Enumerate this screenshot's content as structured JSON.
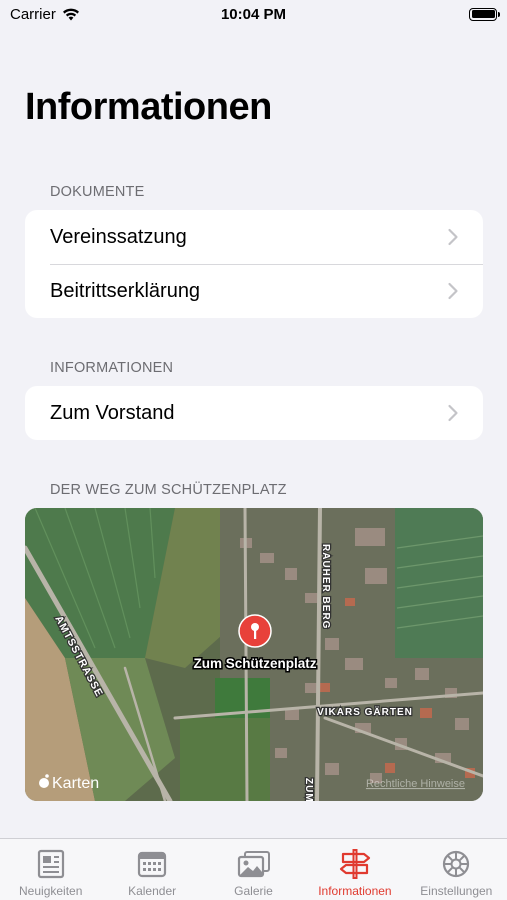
{
  "status_bar": {
    "carrier": "Carrier",
    "time": "10:04 PM"
  },
  "page": {
    "title": "Informationen"
  },
  "sections": {
    "dokumente": {
      "header": "DOKUMENTE",
      "rows": [
        {
          "label": "Vereinssatzung"
        },
        {
          "label": "Beitrittserklärung"
        }
      ]
    },
    "informationen": {
      "header": "INFORMATIONEN",
      "rows": [
        {
          "label": "Zum Vorstand"
        }
      ]
    },
    "weg": {
      "header": "DER WEG ZUM SCHÜTZENPLATZ"
    }
  },
  "map": {
    "pin_label": "Zum Schützenplatz",
    "street_labels": [
      "AMTSSTRASSE",
      "RAUHER BERG",
      "VIKARS GÄRTEN",
      "ZUM"
    ],
    "brand": "Karten",
    "legal": "Rechtliche Hinweise",
    "pin_color": "#e8413a"
  },
  "tab_bar": {
    "tabs": [
      {
        "label": "Neuigkeiten",
        "icon": "newspaper-icon"
      },
      {
        "label": "Kalender",
        "icon": "calendar-icon"
      },
      {
        "label": "Galerie",
        "icon": "photos-icon"
      },
      {
        "label": "Informationen",
        "icon": "signpost-icon",
        "active": true
      },
      {
        "label": "Einstellungen",
        "icon": "gear-icon"
      }
    ],
    "active_color": "#e03a2f",
    "inactive_color": "#8e8e93"
  }
}
